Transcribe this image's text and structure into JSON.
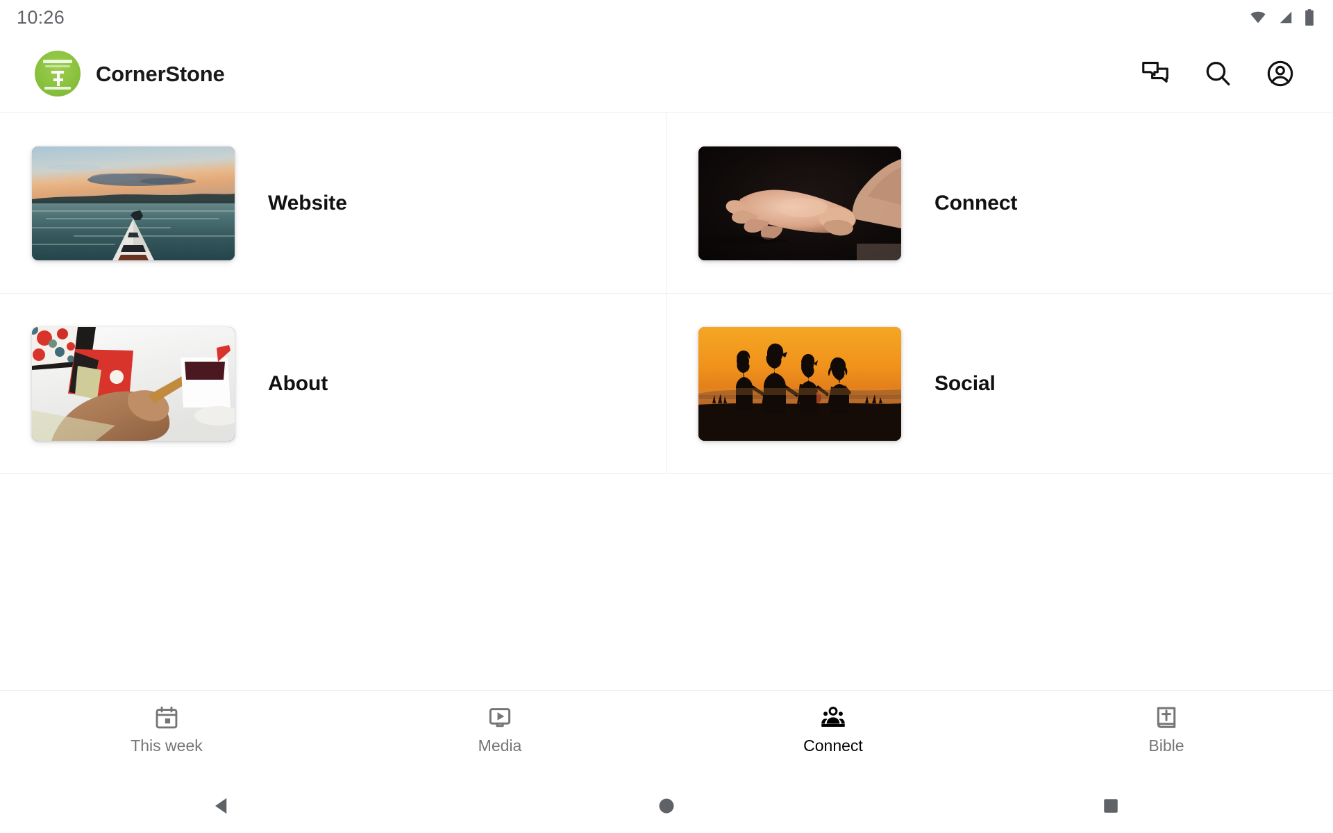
{
  "status_bar": {
    "clock": "10:26",
    "icons": [
      {
        "name": "wifi-icon",
        "label": "Wi-Fi"
      },
      {
        "name": "cellular-signal-icon",
        "label": "Cellular signal"
      },
      {
        "name": "battery-icon",
        "label": "Battery full"
      }
    ]
  },
  "app_bar": {
    "brand_name": "CornerStone",
    "logo_name": "cornerstone-logo",
    "logo_color": "#8dc63f",
    "actions": [
      {
        "name": "chat-icon",
        "label": "Chat"
      },
      {
        "name": "search-icon",
        "label": "Search"
      },
      {
        "name": "account-circle-icon",
        "label": "Account"
      }
    ]
  },
  "tiles": [
    {
      "label": "Website",
      "image": "kayak-on-lake-at-sunset"
    },
    {
      "label": "Connect",
      "image": "open-cupped-hands-on-black"
    },
    {
      "label": "About",
      "image": "person-writing-at-desk-with-coffee"
    },
    {
      "label": "Social",
      "image": "four-silhouettes-holding-hands-at-sunset"
    }
  ],
  "bottom_nav": {
    "active_index": 2,
    "active_color": "#000000",
    "inactive_color": "#757575",
    "items": [
      {
        "label": "This week",
        "icon": "calendar-icon"
      },
      {
        "label": "Media",
        "icon": "video-monitor-icon"
      },
      {
        "label": "Connect",
        "icon": "groups-icon"
      },
      {
        "label": "Bible",
        "icon": "bible-book-icon"
      }
    ]
  },
  "system_nav": {
    "items": [
      {
        "name": "android-back-button",
        "label": "Back"
      },
      {
        "name": "android-home-button",
        "label": "Home"
      },
      {
        "name": "android-recents-button",
        "label": "Recent apps"
      }
    ]
  }
}
